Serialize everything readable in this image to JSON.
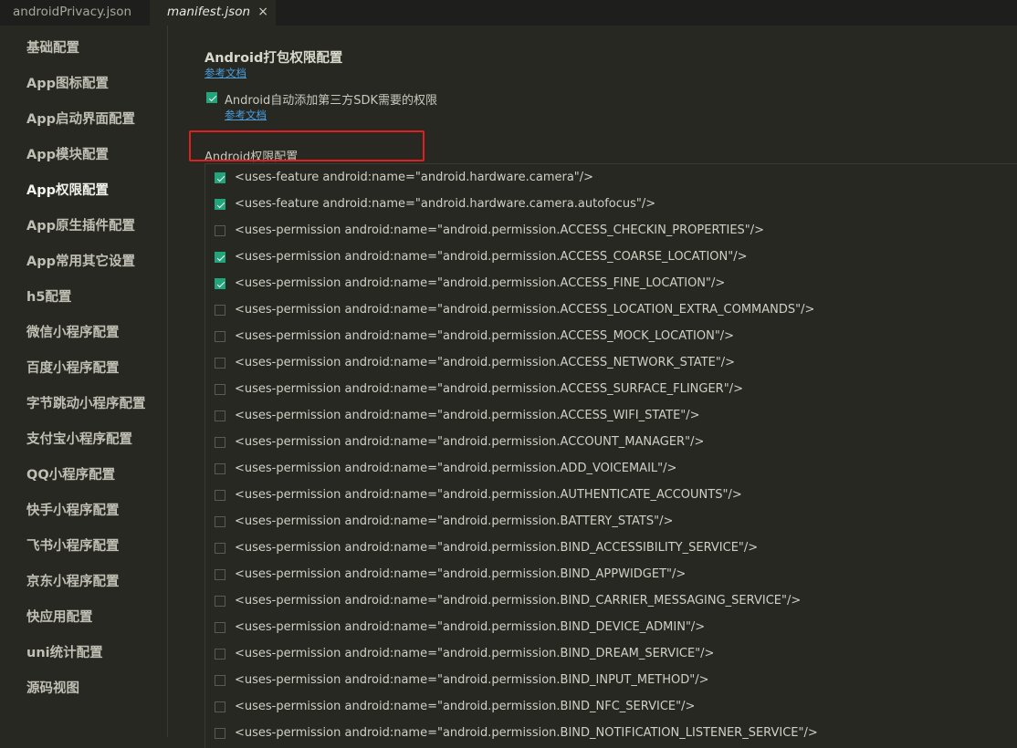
{
  "tabs": [
    {
      "label": "androidPrivacy.json",
      "active": false
    },
    {
      "label": "manifest.json",
      "active": true,
      "close": "×"
    }
  ],
  "sidebar": {
    "items": [
      {
        "label": "基础配置"
      },
      {
        "label": "App图标配置"
      },
      {
        "label": "App启动界面配置"
      },
      {
        "label": "App模块配置"
      },
      {
        "label": "App权限配置",
        "active": true
      },
      {
        "label": "App原生插件配置"
      },
      {
        "label": "App常用其它设置"
      },
      {
        "label": "h5配置"
      },
      {
        "label": "微信小程序配置"
      },
      {
        "label": "百度小程序配置"
      },
      {
        "label": "字节跳动小程序配置"
      },
      {
        "label": "支付宝小程序配置"
      },
      {
        "label": "QQ小程序配置"
      },
      {
        "label": "快手小程序配置"
      },
      {
        "label": "飞书小程序配置"
      },
      {
        "label": "京东小程序配置"
      },
      {
        "label": "快应用配置"
      },
      {
        "label": "uni统计配置"
      },
      {
        "label": "源码视图"
      }
    ]
  },
  "main": {
    "section_title": "Android打包权限配置",
    "doc_link": "参考文档",
    "auto_sdk": {
      "label": "Android自动添加第三方SDK需要的权限",
      "checked": true,
      "doc_link": "参考文档"
    },
    "permissions_heading": "Android权限配置",
    "permissions": [
      {
        "text": "<uses-feature android:name=\"android.hardware.camera\"/>",
        "checked": true
      },
      {
        "text": "<uses-feature android:name=\"android.hardware.camera.autofocus\"/>",
        "checked": true
      },
      {
        "text": "<uses-permission android:name=\"android.permission.ACCESS_CHECKIN_PROPERTIES\"/>",
        "checked": false
      },
      {
        "text": "<uses-permission android:name=\"android.permission.ACCESS_COARSE_LOCATION\"/>",
        "checked": true
      },
      {
        "text": "<uses-permission android:name=\"android.permission.ACCESS_FINE_LOCATION\"/>",
        "checked": true
      },
      {
        "text": "<uses-permission android:name=\"android.permission.ACCESS_LOCATION_EXTRA_COMMANDS\"/>",
        "checked": false
      },
      {
        "text": "<uses-permission android:name=\"android.permission.ACCESS_MOCK_LOCATION\"/>",
        "checked": false
      },
      {
        "text": "<uses-permission android:name=\"android.permission.ACCESS_NETWORK_STATE\"/>",
        "checked": false
      },
      {
        "text": "<uses-permission android:name=\"android.permission.ACCESS_SURFACE_FLINGER\"/>",
        "checked": false
      },
      {
        "text": "<uses-permission android:name=\"android.permission.ACCESS_WIFI_STATE\"/>",
        "checked": false
      },
      {
        "text": "<uses-permission android:name=\"android.permission.ACCOUNT_MANAGER\"/>",
        "checked": false
      },
      {
        "text": "<uses-permission android:name=\"android.permission.ADD_VOICEMAIL\"/>",
        "checked": false
      },
      {
        "text": "<uses-permission android:name=\"android.permission.AUTHENTICATE_ACCOUNTS\"/>",
        "checked": false
      },
      {
        "text": "<uses-permission android:name=\"android.permission.BATTERY_STATS\"/>",
        "checked": false
      },
      {
        "text": "<uses-permission android:name=\"android.permission.BIND_ACCESSIBILITY_SERVICE\"/>",
        "checked": false
      },
      {
        "text": "<uses-permission android:name=\"android.permission.BIND_APPWIDGET\"/>",
        "checked": false
      },
      {
        "text": "<uses-permission android:name=\"android.permission.BIND_CARRIER_MESSAGING_SERVICE\"/>",
        "checked": false
      },
      {
        "text": "<uses-permission android:name=\"android.permission.BIND_DEVICE_ADMIN\"/>",
        "checked": false
      },
      {
        "text": "<uses-permission android:name=\"android.permission.BIND_DREAM_SERVICE\"/>",
        "checked": false
      },
      {
        "text": "<uses-permission android:name=\"android.permission.BIND_INPUT_METHOD\"/>",
        "checked": false
      },
      {
        "text": "<uses-permission android:name=\"android.permission.BIND_NFC_SERVICE\"/>",
        "checked": false
      },
      {
        "text": "<uses-permission android:name=\"android.permission.BIND_NOTIFICATION_LISTENER_SERVICE\"/>",
        "checked": false
      }
    ]
  },
  "colors": {
    "background": "#272822",
    "tabbar": "#1e1f1c",
    "checkbox_checked": "#21a57a",
    "link": "#4a9fe0",
    "highlight_border": "#e02020"
  }
}
